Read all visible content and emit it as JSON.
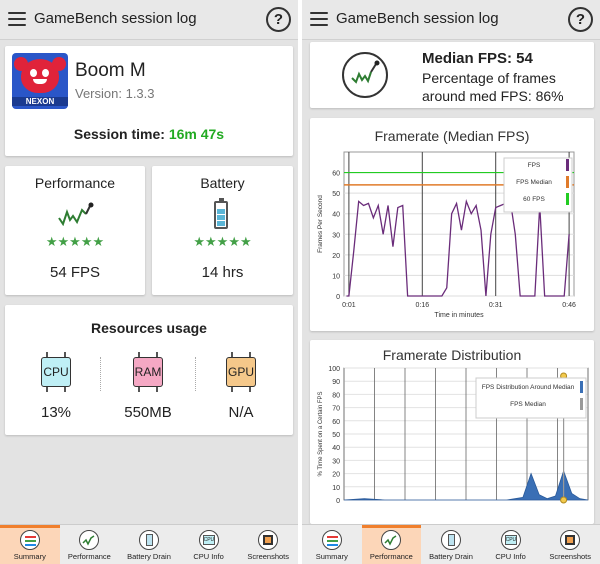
{
  "app": {
    "title": "GameBench session log",
    "help": "?"
  },
  "summary": {
    "game_name": "Boom M",
    "version": "Version: 1.3.3",
    "app_icon_text": "NEXON",
    "session_label": "Session time:",
    "session_value": "16m 47s",
    "performance": {
      "title": "Performance",
      "stars": "★★★★★",
      "value": "54 FPS"
    },
    "battery": {
      "title": "Battery",
      "stars": "★★★★★",
      "value": "14 hrs"
    },
    "resources": {
      "title": "Resources usage",
      "cpu_label": "CPU",
      "cpu_value": "13%",
      "ram_label": "RAM",
      "ram_value": "550MB",
      "gpu_label": "GPU",
      "gpu_value": "N/A"
    }
  },
  "performance_screen": {
    "median_fps": "Median FPS: 54",
    "percentage_line1": "Percentage of frames",
    "percentage_line2": "around med FPS: 86%"
  },
  "chart_data": [
    {
      "type": "line",
      "title": "Framerate (Median FPS)",
      "xlabel": "Time in minutes",
      "ylabel": "Frames Per Second",
      "x_ticks": [
        "0:01",
        "0:16",
        "0:31",
        "0:46"
      ],
      "y_ticks": [
        "0",
        "10",
        "20",
        "30",
        "40",
        "50",
        "60"
      ],
      "ylim": [
        0,
        70
      ],
      "xlim": [
        0,
        47
      ],
      "legend_placement": "top-right",
      "legend": [
        {
          "name": "FPS",
          "color": "#6a2c7a"
        },
        {
          "name": "FPS Median",
          "color": "#e07b2a"
        },
        {
          "name": "60 FPS",
          "color": "#22cc22"
        }
      ],
      "reference_lines": {
        "median": 54,
        "target": 60
      },
      "series": [
        {
          "name": "FPS",
          "x": [
            0.5,
            1,
            2,
            3,
            4,
            5,
            6,
            7,
            8,
            9,
            10,
            11,
            12,
            13,
            14,
            15,
            16,
            17,
            18,
            19,
            20,
            21,
            22,
            23,
            24,
            25,
            26,
            27,
            28,
            29,
            30,
            31,
            32,
            33,
            34,
            35,
            36,
            37,
            38,
            39,
            40,
            41,
            42,
            43,
            44,
            45,
            46
          ],
          "y": [
            0,
            0,
            22,
            46,
            44,
            45,
            38,
            44,
            30,
            44,
            24,
            43,
            44,
            0,
            0,
            0,
            0,
            0,
            0,
            0,
            0,
            4,
            40,
            45,
            32,
            46,
            40,
            44,
            32,
            0,
            30,
            43,
            44,
            45,
            46,
            30,
            0,
            0,
            0,
            0,
            44,
            0,
            0,
            0,
            0,
            0,
            30
          ]
        }
      ]
    },
    {
      "type": "area",
      "title": "Framerate Distribution",
      "ylabel": "% Time Spent on a Certain FPS",
      "y_ticks": [
        "0",
        "10",
        "20",
        "30",
        "40",
        "50",
        "60",
        "70",
        "80",
        "90",
        "100"
      ],
      "ylim": [
        0,
        100
      ],
      "legend_placement": "top-right",
      "legend": [
        {
          "name": "FPS Distribution Around Median",
          "color": "#3a6fb5"
        },
        {
          "name": "FPS Median",
          "color": "#999999"
        }
      ],
      "series": [
        {
          "name": "FPS Distribution Around Median",
          "x": [
            0,
            5,
            10,
            20,
            30,
            40,
            44,
            46,
            48,
            50,
            52,
            54,
            56,
            58,
            60
          ],
          "y": [
            0,
            1,
            0,
            0,
            0,
            0,
            2,
            20,
            4,
            1,
            3,
            22,
            5,
            1,
            0
          ]
        }
      ],
      "median_marker": 54
    }
  ],
  "nav": {
    "items": [
      {
        "label": "Summary"
      },
      {
        "label": "Performance"
      },
      {
        "label": "Battery Drain"
      },
      {
        "label": "CPU Info"
      },
      {
        "label": "Screenshots"
      }
    ],
    "cpu_icon_text": "CPU"
  },
  "colors": {
    "session_value": "#22aa22",
    "accent": "#f07f2c",
    "cpu_chip": "#bfeff5",
    "ram_chip": "#f5a8c4",
    "gpu_chip": "#f5c88a"
  }
}
